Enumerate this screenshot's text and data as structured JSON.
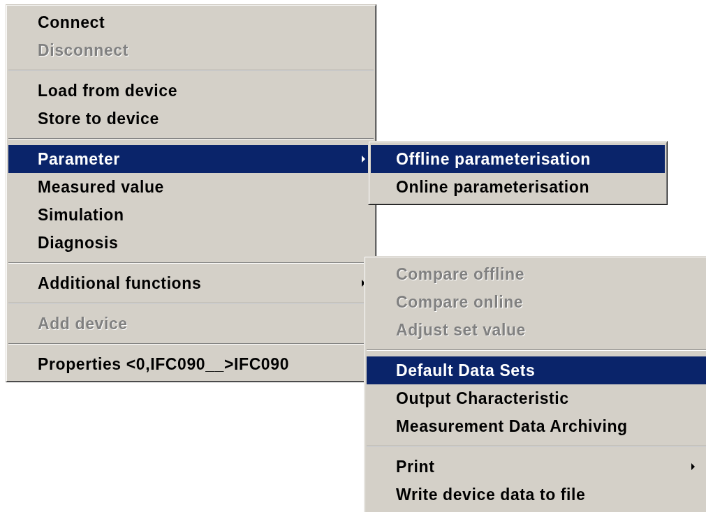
{
  "menus": [
    {
      "kind": "main",
      "groups": [
        [
          {
            "label": "Connect",
            "disabled": false,
            "selected": false,
            "submenu": false
          },
          {
            "label": "Disconnect",
            "disabled": true,
            "selected": false,
            "submenu": false
          }
        ],
        [
          {
            "label": "Load from device",
            "disabled": false,
            "selected": false,
            "submenu": false
          },
          {
            "label": "Store to device",
            "disabled": false,
            "selected": false,
            "submenu": false
          }
        ],
        [
          {
            "label": "Parameter",
            "disabled": false,
            "selected": true,
            "submenu": true
          },
          {
            "label": "Measured value",
            "disabled": false,
            "selected": false,
            "submenu": false
          },
          {
            "label": "Simulation",
            "disabled": false,
            "selected": false,
            "submenu": false
          },
          {
            "label": "Diagnosis",
            "disabled": false,
            "selected": false,
            "submenu": false
          }
        ],
        [
          {
            "label": "Additional functions",
            "disabled": false,
            "selected": false,
            "submenu": true
          }
        ],
        [
          {
            "label": "Add device",
            "disabled": true,
            "selected": false,
            "submenu": false
          }
        ],
        [
          {
            "label": "Properties <0,IFC090__>IFC090",
            "disabled": false,
            "selected": false,
            "submenu": false
          }
        ]
      ]
    },
    {
      "kind": "parameter",
      "groups": [
        [
          {
            "label": "Offline parameterisation",
            "disabled": false,
            "selected": true,
            "submenu": false
          },
          {
            "label": "Online parameterisation",
            "disabled": false,
            "selected": false,
            "submenu": false
          }
        ]
      ]
    },
    {
      "kind": "additional",
      "groups": [
        [
          {
            "label": "Compare offline",
            "disabled": true,
            "selected": false,
            "submenu": false
          },
          {
            "label": "Compare online",
            "disabled": true,
            "selected": false,
            "submenu": false
          },
          {
            "label": "Adjust set value",
            "disabled": true,
            "selected": false,
            "submenu": false
          }
        ],
        [
          {
            "label": "Default Data Sets",
            "disabled": false,
            "selected": true,
            "submenu": false
          },
          {
            "label": "Output Characteristic",
            "disabled": false,
            "selected": false,
            "submenu": false
          },
          {
            "label": "Measurement Data Archiving",
            "disabled": false,
            "selected": false,
            "submenu": false
          }
        ],
        [
          {
            "label": "Print",
            "disabled": false,
            "selected": false,
            "submenu": true
          },
          {
            "label": "Write device data to file",
            "disabled": false,
            "selected": false,
            "submenu": false
          }
        ]
      ]
    }
  ]
}
